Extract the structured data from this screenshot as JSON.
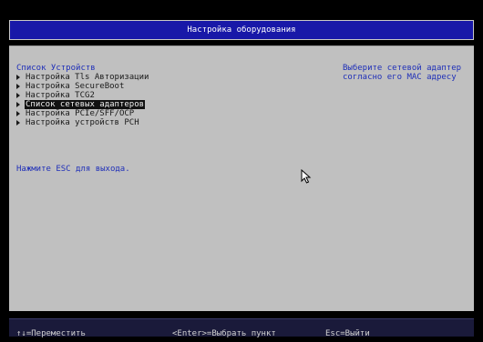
{
  "header": {
    "title": "Настройка оборудования"
  },
  "main": {
    "section_title": "Список Устройств",
    "items": [
      {
        "label": "Настройка Tls Авторизации",
        "selected": false
      },
      {
        "label": "Настройка SecureBoot",
        "selected": false
      },
      {
        "label": "Настройка TCG2",
        "selected": false
      },
      {
        "label": "Список сетевых адаптеров",
        "selected": true
      },
      {
        "label": "Настройка PCIe/SFF/OCP",
        "selected": false
      },
      {
        "label": "Настройка устройств PCH",
        "selected": false
      }
    ],
    "exit_hint": "Нажмите ESC для выхода."
  },
  "help_panel": {
    "line1": "Выберите сетевой адаптер",
    "line2": "согласно его MAC адресу"
  },
  "footer": {
    "move": "↑↓=Переместить",
    "enter": "<Enter>=Выбрать пункт",
    "esc": "Esc=Выйти"
  },
  "icons": {
    "cursor": "mouse-pointer-icon",
    "item_marker": "triangle-right-icon"
  },
  "colors": {
    "title_bar": "#1818a8",
    "panel": "#c0c0c0",
    "accent_text": "#1f2fb8",
    "selected_bg": "#111111",
    "footer_bg": "#1a1a3a"
  }
}
